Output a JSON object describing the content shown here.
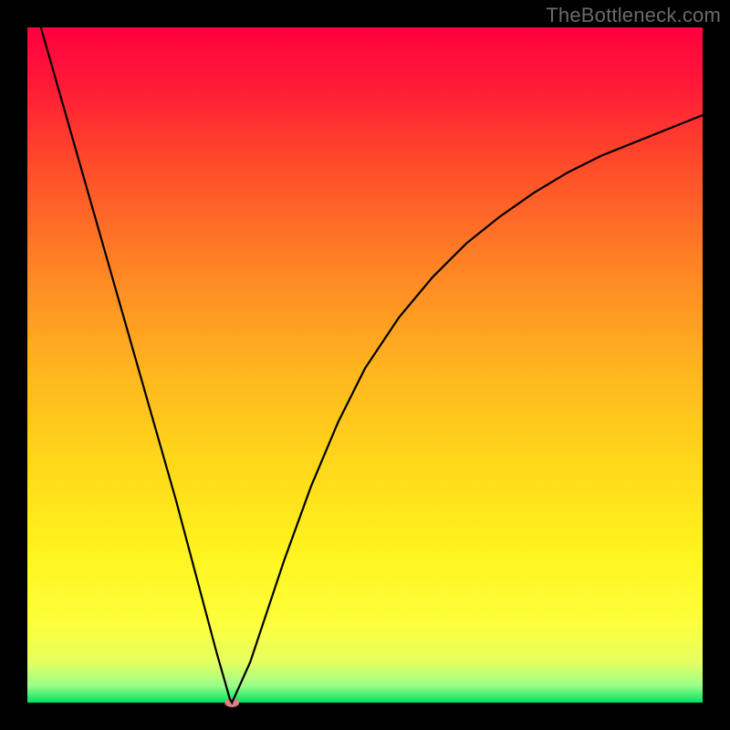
{
  "watermark": "TheBottleneck.com",
  "chart_data": {
    "type": "line",
    "title": "",
    "xlabel": "",
    "ylabel": "",
    "xlim": [
      0,
      100
    ],
    "ylim": [
      0,
      100
    ],
    "grid": false,
    "legend": false,
    "background": "vertical rainbow gradient (red→orange→yellow→green)",
    "plot_area_border_px": 30,
    "series": [
      {
        "name": "curve",
        "color": "#000000",
        "x": [
          2,
          4,
          6,
          8,
          10,
          12,
          14,
          16,
          18,
          20,
          22,
          24,
          26,
          28,
          30,
          30.3,
          33,
          35,
          38,
          42,
          46,
          50,
          55,
          60,
          65,
          70,
          75,
          80,
          85,
          90,
          95,
          100
        ],
        "values": [
          100,
          93,
          86,
          79,
          72,
          65,
          58,
          51,
          44,
          37,
          30,
          22.5,
          15,
          7.5,
          0.5,
          0,
          6,
          12,
          21,
          32,
          41.5,
          49.5,
          57,
          63,
          68,
          72,
          75.5,
          78.5,
          81,
          83,
          85,
          87
        ]
      }
    ],
    "markers": [
      {
        "name": "minimum-dot",
        "x": 30.3,
        "y": 0,
        "color": "#d98080",
        "rx": 8,
        "ry": 5
      }
    ],
    "gradient_stops": [
      {
        "offset": 0.0,
        "color": "#ff003f"
      },
      {
        "offset": 0.08,
        "color": "#ff1838"
      },
      {
        "offset": 0.2,
        "color": "#ff4a2a"
      },
      {
        "offset": 0.35,
        "color": "#ff8225"
      },
      {
        "offset": 0.5,
        "color": "#ffb31f"
      },
      {
        "offset": 0.65,
        "color": "#ffd91a"
      },
      {
        "offset": 0.78,
        "color": "#fff41f"
      },
      {
        "offset": 0.88,
        "color": "#fdff3a"
      },
      {
        "offset": 0.94,
        "color": "#e6ff60"
      },
      {
        "offset": 0.975,
        "color": "#9aff88"
      },
      {
        "offset": 1.0,
        "color": "#00e060"
      }
    ]
  }
}
